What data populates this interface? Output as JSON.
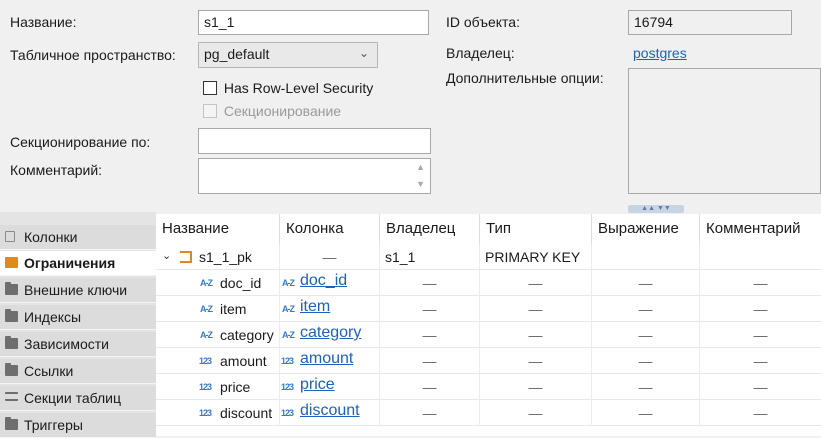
{
  "form": {
    "name_label": "Название:",
    "name_value": "s1_1",
    "tablespace_label": "Табличное пространство:",
    "tablespace_value": "pg_default",
    "rls_label": "Has Row-Level Security",
    "partitioning_label": "Секционирование",
    "partition_by_label": "Секционирование по:",
    "partition_by_value": "",
    "comment_label": "Комментарий:",
    "comment_value": "",
    "object_id_label": "ID объекта:",
    "object_id_value": "16794",
    "owner_label": "Владелец:",
    "owner_value": "postgres",
    "extra_options_label": "Дополнительные опции:"
  },
  "sidebar": {
    "items": [
      {
        "label": "Колонки",
        "icon": "columns-icon"
      },
      {
        "label": "Ограничения",
        "icon": "constraint-icon"
      },
      {
        "label": "Внешние ключи",
        "icon": "folder-icon"
      },
      {
        "label": "Индексы",
        "icon": "folder-icon"
      },
      {
        "label": "Зависимости",
        "icon": "folder-icon"
      },
      {
        "label": "Ссылки",
        "icon": "folder-icon"
      },
      {
        "label": "Секции таблиц",
        "icon": "partitions-icon"
      },
      {
        "label": "Триггеры",
        "icon": "folder-icon"
      }
    ]
  },
  "table": {
    "headers": [
      "Название",
      "Колонка",
      "Владелец",
      "Тип",
      "Выражение",
      "Комментарий"
    ],
    "constraint": {
      "name": "s1_1_pk",
      "column": "—",
      "owner": "s1_1",
      "type": "PRIMARY KEY"
    },
    "rows": [
      {
        "name": "doc_id",
        "kind": "text",
        "column": "doc_id",
        "owner": "—",
        "type": "—",
        "expr": "—",
        "comment": "—"
      },
      {
        "name": "item",
        "kind": "text",
        "column": "item",
        "owner": "—",
        "type": "—",
        "expr": "—",
        "comment": "—"
      },
      {
        "name": "category",
        "kind": "text",
        "column": "category",
        "owner": "—",
        "type": "—",
        "expr": "—",
        "comment": "—"
      },
      {
        "name": "amount",
        "kind": "number",
        "column": "amount",
        "owner": "—",
        "type": "—",
        "expr": "—",
        "comment": "—"
      },
      {
        "name": "price",
        "kind": "number",
        "column": "price",
        "owner": "—",
        "type": "—",
        "expr": "—",
        "comment": "—"
      },
      {
        "name": "discount",
        "kind": "number",
        "column": "discount",
        "owner": "—",
        "type": "—",
        "expr": "—",
        "comment": "—"
      }
    ]
  },
  "icons": {
    "text_type": "A-Z",
    "number_type": "123"
  },
  "colors": {
    "link": "#1c62b9",
    "type_icon": "#3a79c8",
    "active_icon": "#e08a1e"
  }
}
